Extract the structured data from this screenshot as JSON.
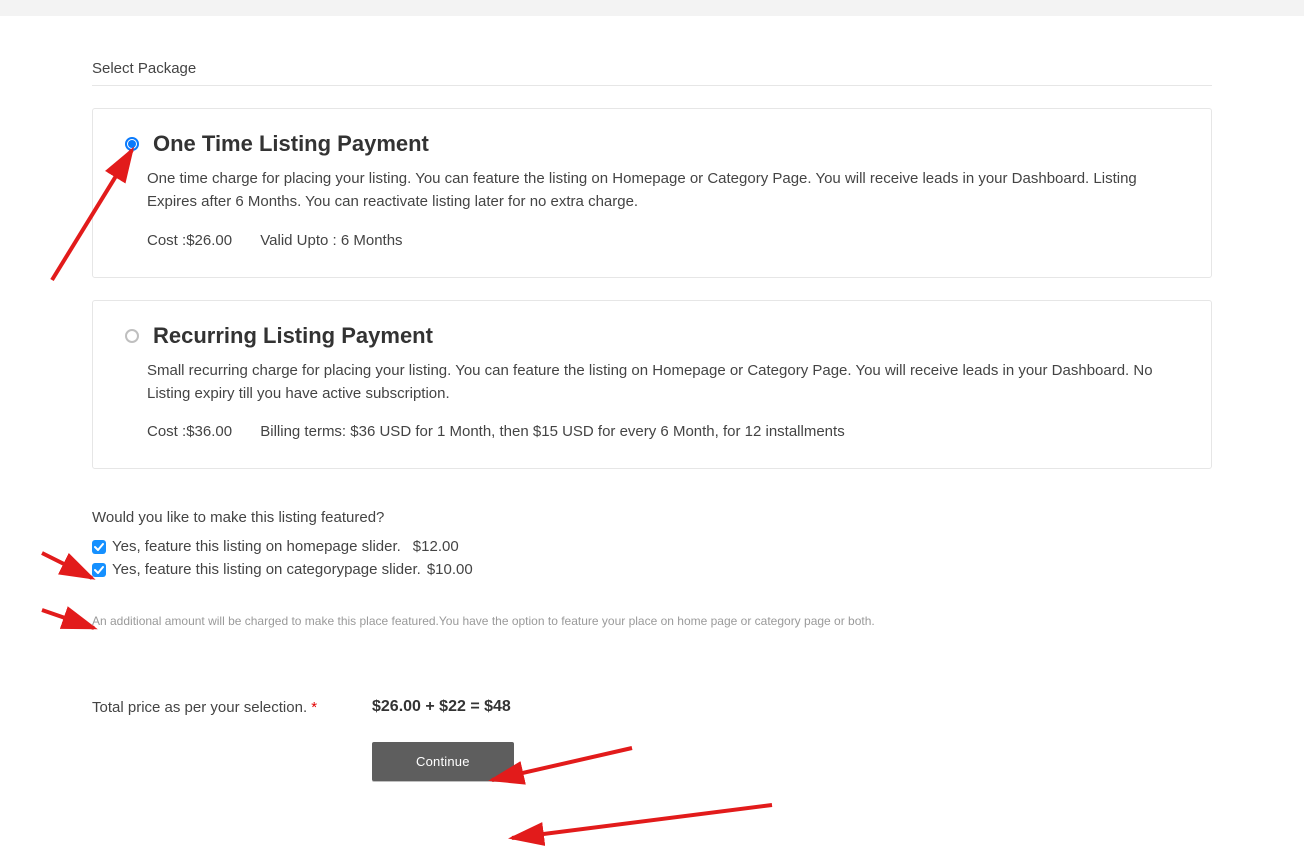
{
  "section_title": "Select Package",
  "packages": [
    {
      "title": "One Time Listing Payment",
      "selected": true,
      "description": "One time charge for placing your listing. You can feature the listing on Homepage or Category Page. You will receive leads in your Dashboard. Listing Expires after 6 Months. You can reactivate listing later for no extra charge.",
      "cost_label": "Cost :",
      "cost_value": "$26.00",
      "extra_label": "Valid Upto :",
      "extra_value": "6 Months"
    },
    {
      "title": "Recurring Listing Payment",
      "selected": false,
      "description": "Small recurring charge for placing your listing. You can feature the listing on Homepage or Category Page. You will receive leads in your Dashboard. No Listing expiry till you have active subscription.",
      "cost_label": "Cost :",
      "cost_value": "$36.00",
      "extra_label": "Billing terms:",
      "extra_value": "$36 USD for 1 Month, then $15 USD for every 6 Month, for 12 installments"
    }
  ],
  "featured_question": "Would you like to make this listing featured?",
  "feature_options": [
    {
      "checked": true,
      "label": "Yes, feature this listing on homepage slider.",
      "price": "$12.00"
    },
    {
      "checked": true,
      "label": "Yes, feature this listing on categorypage slider.",
      "price": "$10.00"
    }
  ],
  "featured_note": "An additional amount will be charged to make this place featured.You have the option to feature your place on home page or category page or both.",
  "total_label": "Total price as per your selection.",
  "required_mark": "*",
  "total_expression": "$26.00 + $22 = $48",
  "continue_label": "Continue",
  "arrow_color": "#e21b1b"
}
